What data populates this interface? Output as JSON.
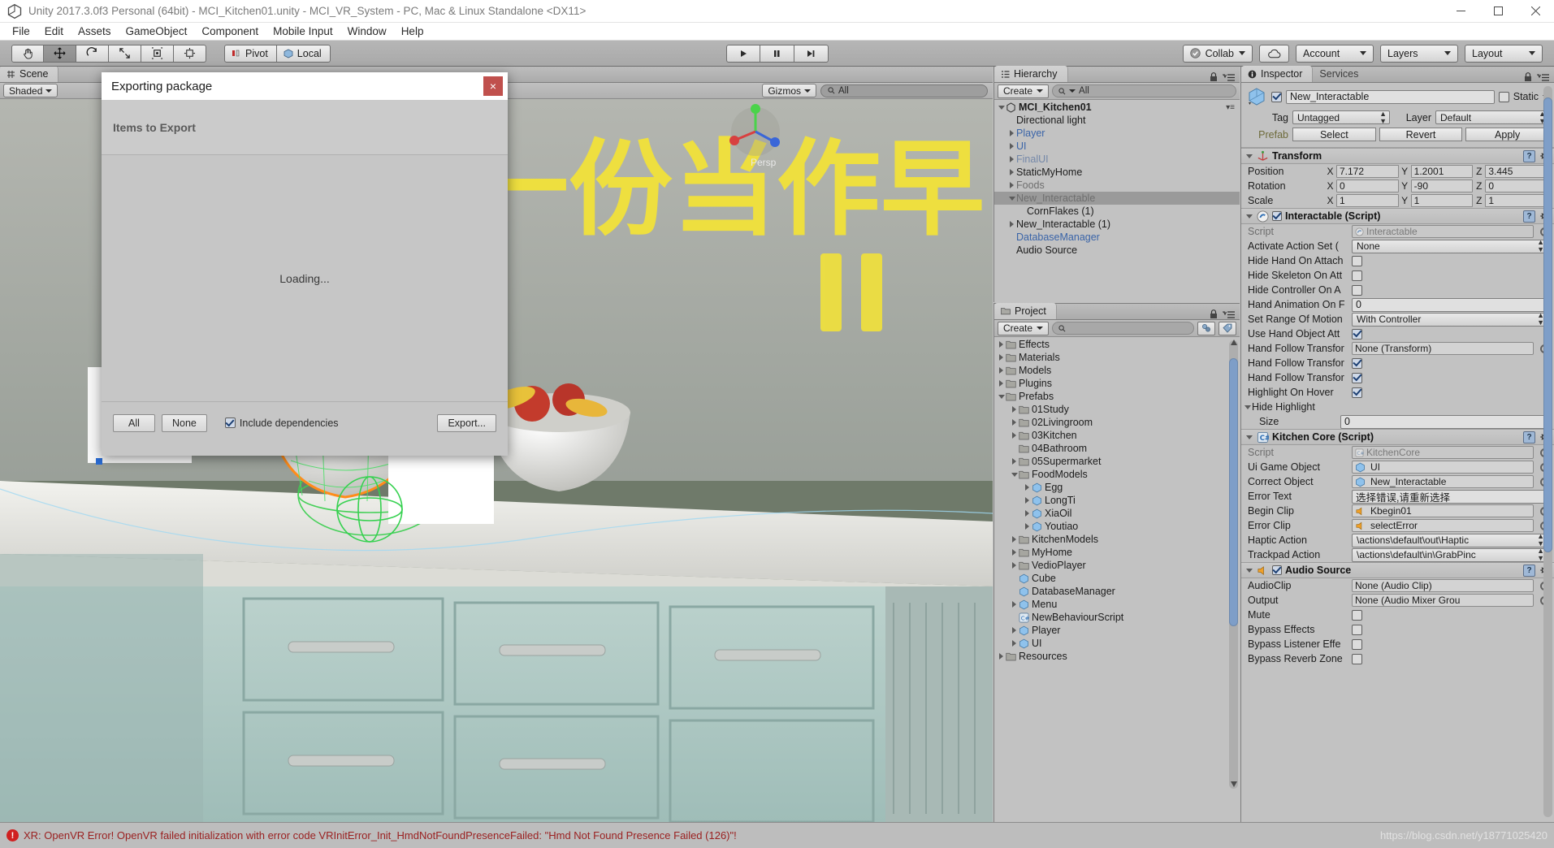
{
  "window": {
    "title": "Unity 2017.3.0f3 Personal (64bit) - MCI_Kitchen01.unity - MCI_VR_System - PC, Mac & Linux Standalone <DX11>",
    "minimize": "minimize-icon",
    "maximize": "maximize-icon",
    "close": "close-icon"
  },
  "menubar": {
    "items": [
      "File",
      "Edit",
      "Assets",
      "GameObject",
      "Component",
      "Mobile Input",
      "Window",
      "Help"
    ]
  },
  "toolbar": {
    "tools": [
      "hand-tool",
      "move-tool",
      "rotate-tool",
      "scale-tool",
      "rect-tool",
      "transform-tool"
    ],
    "active_tool_index": 1,
    "pivot_label": "Pivot",
    "local_label": "Local",
    "play_label": "play-button",
    "pause_label": "pause-button",
    "step_label": "step-button",
    "collab_label": "Collab",
    "cloud_label": "cloud-button",
    "account_label": "Account",
    "layers_label": "Layers",
    "layout_label": "Layout"
  },
  "scene": {
    "tab_label": "Scene",
    "shading_mode": "Shaded",
    "gizmos_label": "Gizmos",
    "search_placeholder": "All"
  },
  "hierarchy": {
    "tab_label": "Hierarchy",
    "create_label": "Create",
    "search_value": "All",
    "items": [
      {
        "label": "MCI_Kitchen01",
        "depth": 0,
        "arrow": "open",
        "style": "scene",
        "selected": false
      },
      {
        "label": "Directional light",
        "depth": 1,
        "arrow": "none",
        "style": "normal",
        "selected": false
      },
      {
        "label": "Player",
        "depth": 1,
        "arrow": "closed",
        "style": "prefab",
        "selected": false
      },
      {
        "label": "UI",
        "depth": 1,
        "arrow": "closed",
        "style": "prefab",
        "selected": false
      },
      {
        "label": "FinalUI",
        "depth": 1,
        "arrow": "closed",
        "style": "dimprefab",
        "selected": false
      },
      {
        "label": "StaticMyHome",
        "depth": 1,
        "arrow": "closed",
        "style": "normal",
        "selected": false
      },
      {
        "label": "Foods",
        "depth": 1,
        "arrow": "closed",
        "style": "dim",
        "selected": false
      },
      {
        "label": "New_Interactable",
        "depth": 1,
        "arrow": "open",
        "style": "dim",
        "selected": true
      },
      {
        "label": "CornFlakes (1)",
        "depth": 2,
        "arrow": "none",
        "style": "normal",
        "selected": false
      },
      {
        "label": "New_Interactable (1)",
        "depth": 1,
        "arrow": "closed",
        "style": "normal",
        "selected": false
      },
      {
        "label": "DatabaseManager",
        "depth": 1,
        "arrow": "none",
        "style": "prefab",
        "selected": false
      },
      {
        "label": "Audio Source",
        "depth": 1,
        "arrow": "none",
        "style": "normal",
        "selected": false
      }
    ]
  },
  "project": {
    "tab_label": "Project",
    "create_label": "Create",
    "search_value": "",
    "items": [
      {
        "label": "Effects",
        "depth": 0,
        "arrow": "closed",
        "icon": "folder"
      },
      {
        "label": "Materials",
        "depth": 0,
        "arrow": "closed",
        "icon": "folder"
      },
      {
        "label": "Models",
        "depth": 0,
        "arrow": "closed",
        "icon": "folder"
      },
      {
        "label": "Plugins",
        "depth": 0,
        "arrow": "closed",
        "icon": "folder"
      },
      {
        "label": "Prefabs",
        "depth": 0,
        "arrow": "open",
        "icon": "folder"
      },
      {
        "label": "01Study",
        "depth": 1,
        "arrow": "closed",
        "icon": "folder"
      },
      {
        "label": "02Livingroom",
        "depth": 1,
        "arrow": "closed",
        "icon": "folder"
      },
      {
        "label": "03Kitchen",
        "depth": 1,
        "arrow": "closed",
        "icon": "folder"
      },
      {
        "label": "04Bathroom",
        "depth": 1,
        "arrow": "none",
        "icon": "folder"
      },
      {
        "label": "05Supermarket",
        "depth": 1,
        "arrow": "closed",
        "icon": "folder"
      },
      {
        "label": "FoodModels",
        "depth": 1,
        "arrow": "open",
        "icon": "folder"
      },
      {
        "label": "Egg",
        "depth": 2,
        "arrow": "closed",
        "icon": "prefab"
      },
      {
        "label": "LongTi",
        "depth": 2,
        "arrow": "closed",
        "icon": "prefab"
      },
      {
        "label": "XiaOil",
        "depth": 2,
        "arrow": "closed",
        "icon": "prefab"
      },
      {
        "label": "Youtiao",
        "depth": 2,
        "arrow": "closed",
        "icon": "prefab"
      },
      {
        "label": "KitchenModels",
        "depth": 1,
        "arrow": "closed",
        "icon": "folder"
      },
      {
        "label": "MyHome",
        "depth": 1,
        "arrow": "closed",
        "icon": "folder"
      },
      {
        "label": "VedioPlayer",
        "depth": 1,
        "arrow": "closed",
        "icon": "folder"
      },
      {
        "label": "Cube",
        "depth": 1,
        "arrow": "none",
        "icon": "prefab"
      },
      {
        "label": "DatabaseManager",
        "depth": 1,
        "arrow": "none",
        "icon": "prefab"
      },
      {
        "label": "Menu",
        "depth": 1,
        "arrow": "closed",
        "icon": "prefab"
      },
      {
        "label": "NewBehaviourScript",
        "depth": 1,
        "arrow": "none",
        "icon": "script"
      },
      {
        "label": "Player",
        "depth": 1,
        "arrow": "closed",
        "icon": "prefab"
      },
      {
        "label": "UI",
        "depth": 1,
        "arrow": "closed",
        "icon": "prefab"
      },
      {
        "label": "Resources",
        "depth": 0,
        "arrow": "closed",
        "icon": "folder"
      }
    ]
  },
  "inspector": {
    "tab_label": "Inspector",
    "services_tab_label": "Services",
    "object_name": "New_Interactable",
    "object_enabled": true,
    "static_label": "Static",
    "static_checked": false,
    "tag_label": "Tag",
    "tag_value": "Untagged",
    "layer_label": "Layer",
    "layer_value": "Default",
    "prefab_label": "Prefab",
    "prefab_buttons": [
      "Select",
      "Revert",
      "Apply"
    ],
    "transform": {
      "title": "Transform",
      "rows": [
        {
          "label": "Position",
          "x": "7.172",
          "y": "1.2001",
          "z": "3.445"
        },
        {
          "label": "Rotation",
          "x": "0",
          "y": "-90",
          "z": "0"
        },
        {
          "label": "Scale",
          "x": "1",
          "y": "1",
          "z": "1"
        }
      ]
    },
    "interactable": {
      "title": "Interactable (Script)",
      "enabled": true,
      "script_label": "Script",
      "script_value": "Interactable",
      "rows": [
        {
          "label": "Activate Action Set (",
          "type": "dropdown",
          "value": "None"
        },
        {
          "label": "Hide Hand On Attach",
          "type": "checkbox",
          "value": false
        },
        {
          "label": "Hide Skeleton On Att",
          "type": "checkbox",
          "value": false
        },
        {
          "label": "Hide Controller On A",
          "type": "checkbox",
          "value": false
        },
        {
          "label": "Hand Animation On F",
          "type": "text",
          "value": "0"
        },
        {
          "label": "Set Range Of Motion",
          "type": "dropdown",
          "value": "With Controller"
        },
        {
          "label": "Use Hand Object Att",
          "type": "checkbox",
          "value": true
        },
        {
          "label": "Hand Follow Transfor",
          "type": "object",
          "value": "None (Transform)"
        },
        {
          "label": "Hand Follow Transfor",
          "type": "checkbox",
          "value": true
        },
        {
          "label": "Hand Follow Transfor",
          "type": "checkbox",
          "value": true
        },
        {
          "label": "Highlight On Hover",
          "type": "checkbox",
          "value": true
        }
      ],
      "hide_highlight_label": "Hide Highlight",
      "size_label": "Size",
      "size_value": "0"
    },
    "kitchen_core": {
      "title": "Kitchen Core (Script)",
      "script_label": "Script",
      "script_value": "KitchenCore",
      "rows": [
        {
          "label": "Ui Game Object",
          "type": "object",
          "value": "UI",
          "icon": "prefab"
        },
        {
          "label": "Correct Object",
          "type": "object",
          "value": "New_Interactable",
          "icon": "prefab"
        },
        {
          "label": "Error Text",
          "type": "text",
          "value": "选择错误,请重新选择"
        },
        {
          "label": "Begin Clip",
          "type": "object",
          "value": "Kbegin01",
          "icon": "audio"
        },
        {
          "label": "Error Clip",
          "type": "object",
          "value": "selectError",
          "icon": "audio"
        },
        {
          "label": "Haptic Action",
          "type": "dropdown",
          "value": "\\actions\\default\\out\\Haptic"
        },
        {
          "label": "Trackpad Action",
          "type": "dropdown",
          "value": "\\actions\\default\\in\\GrabPinc"
        }
      ]
    },
    "audio_source": {
      "title": "Audio Source",
      "enabled": true,
      "rows": [
        {
          "label": "AudioClip",
          "type": "object",
          "value": "None (Audio Clip)"
        },
        {
          "label": "Output",
          "type": "object",
          "value": "None (Audio Mixer Grou"
        },
        {
          "label": "Mute",
          "type": "checkbox",
          "value": false
        },
        {
          "label": "Bypass Effects",
          "type": "checkbox",
          "value": false
        },
        {
          "label": "Bypass Listener Effe",
          "type": "checkbox",
          "value": false
        },
        {
          "label": "Bypass Reverb Zone",
          "type": "checkbox",
          "value": false
        }
      ]
    }
  },
  "export_dialog": {
    "title": "Exporting package",
    "close_label": "×",
    "items_header": "Items to Export",
    "loading_text": "Loading...",
    "all_label": "All",
    "none_label": "None",
    "include_dependencies_label": "Include dependencies",
    "include_dependencies_checked": true,
    "export_label": "Export..."
  },
  "statusbar": {
    "error_text": "XR: OpenVR Error! OpenVR failed initialization with error code VRInitError_Init_HmdNotFoundPresenceFailed: \"Hmd Not Found Presence Failed (126)\"!",
    "watermark": "https://blog.csdn.net/y18771025420"
  },
  "colors": {
    "accent_blue": "#3a64a8",
    "error_red": "#9a2020",
    "panel_gray": "#c2c2c2",
    "dialog_close": "#c0504d"
  }
}
